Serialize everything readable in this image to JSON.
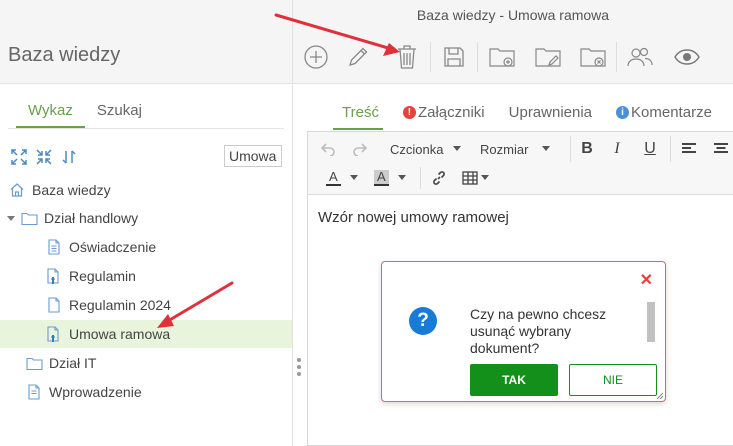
{
  "window": {
    "title": "Baza wiedzy - Umowa ramowa"
  },
  "app": {
    "title": "Baza wiedzy"
  },
  "left_tabs": [
    {
      "label": "Wykaz",
      "active": true
    },
    {
      "label": "Szukaj",
      "active": false
    }
  ],
  "tree_search": {
    "value": "Umowa"
  },
  "tree": {
    "root": "Baza wiedzy",
    "folder_handlowy": "Dział handlowy",
    "items": [
      "Oświadczenie",
      "Regulamin",
      "Regulamin 2024",
      "Umowa ramowa"
    ],
    "folder_it": "Dział IT",
    "intro": "Wprowadzenie"
  },
  "content_tabs": [
    {
      "label": "Treść",
      "active": true,
      "badge": ""
    },
    {
      "label": "Załączniki",
      "active": false,
      "badge": "!"
    },
    {
      "label": "Uprawnienia",
      "active": false,
      "badge": ""
    },
    {
      "label": "Komentarze",
      "active": false,
      "badge": "i"
    }
  ],
  "editor": {
    "font_label": "Czcionka",
    "size_label": "Rozmiar",
    "text_color_label": "A",
    "bg_color_label": "A",
    "body": "Wzór nowej umowy ramowej"
  },
  "dialog": {
    "message": "Czy na pewno chcesz usunąć wybrany dokument?",
    "yes_label": "TAK",
    "no_label": "NIE"
  },
  "colors": {
    "accent_green": "#6aa04a",
    "button_green": "#12901a",
    "dialog_border": "#dd6666",
    "arrow_red": "#e0303a",
    "info_blue": "#1a7bd6",
    "error_red": "#e0443b"
  }
}
